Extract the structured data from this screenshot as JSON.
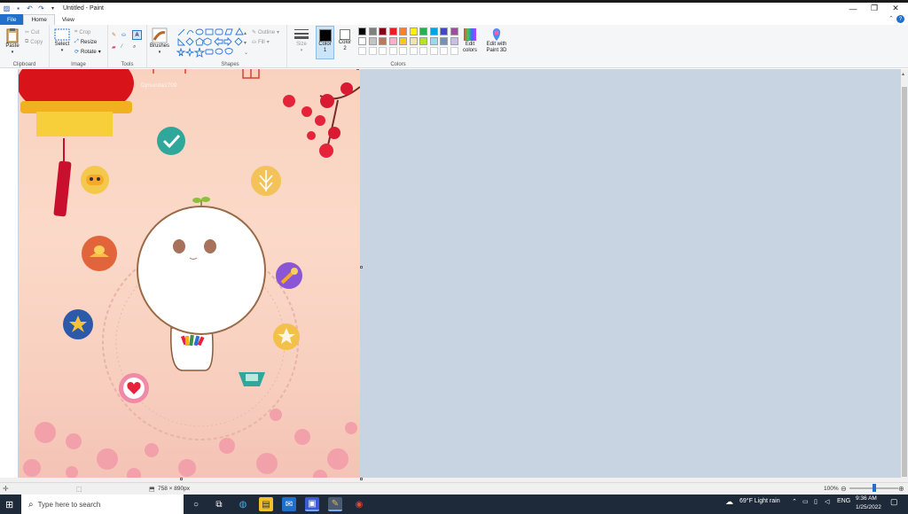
{
  "window": {
    "title": "Untitled - Paint"
  },
  "quick_access": {
    "icons": [
      "paint-app-icon",
      "save-icon",
      "undo-icon",
      "redo-icon",
      "customize-icon"
    ]
  },
  "tabs": [
    {
      "label": "File"
    },
    {
      "label": "Home"
    },
    {
      "label": "View"
    }
  ],
  "ribbon": {
    "clipboard": {
      "label": "Clipboard",
      "paste": "Paste",
      "cut": "Cut",
      "copy": "Copy"
    },
    "image": {
      "label": "Image",
      "select": "Select",
      "crop": "Crop",
      "resize": "Resize",
      "rotate": "Rotate"
    },
    "tools": {
      "label": "Tools"
    },
    "brushes": {
      "label": "Brushes"
    },
    "shapes": {
      "label": "Shapes",
      "outline": "Outline",
      "fill": "Fill"
    },
    "size": {
      "label": "Size"
    },
    "color1": {
      "label": "Color 1",
      "line1": "Color",
      "line2": "1",
      "value": "#000000"
    },
    "color2": {
      "label": "Color 2",
      "line1": "Color",
      "line2": "2",
      "value": "#ffffff"
    },
    "colors": {
      "label": "Colors",
      "row1": [
        "#000000",
        "#7f7f7f",
        "#880015",
        "#ed1c24",
        "#ff7f27",
        "#fff200",
        "#22b14c",
        "#00a2e8",
        "#3f48cc",
        "#a349a4"
      ],
      "row2": [
        "#ffffff",
        "#c3c3c3",
        "#b97a57",
        "#ffaec9",
        "#ffc90e",
        "#efe4b0",
        "#b5e61d",
        "#99d9ea",
        "#7092be",
        "#c8bfe7"
      ]
    },
    "edit_colors": {
      "line1": "Edit",
      "line2": "colors"
    },
    "paint3d": {
      "line1": "Edit with",
      "line2": "Paint 3D"
    }
  },
  "canvas": {
    "watermark": "Djmunda1709"
  },
  "status": {
    "dimensions": "758 × 890px",
    "zoom": "100%",
    "zoom_level": 0.5
  },
  "taskbar": {
    "search_placeholder": "Type here to search",
    "weather": "69°F  Light rain",
    "language": "ENG",
    "time": "9:36 AM",
    "date": "1/25/2022"
  }
}
